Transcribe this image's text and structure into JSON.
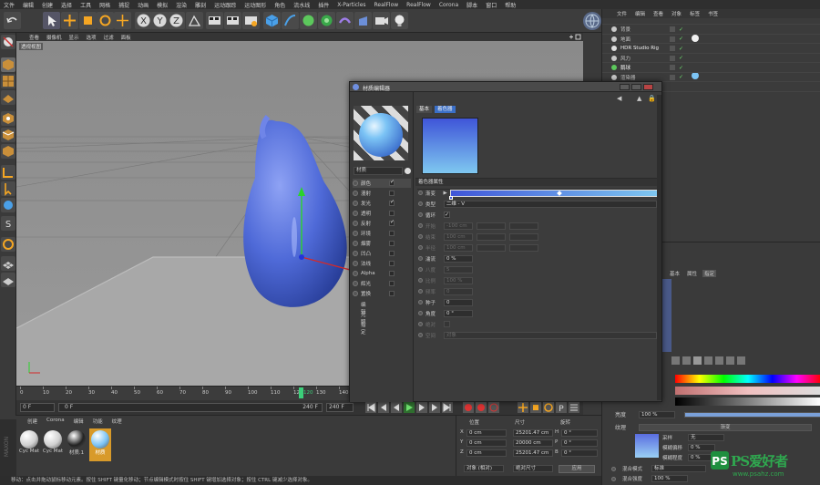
{
  "menubar": [
    "文件",
    "编辑",
    "创建",
    "选择",
    "工具",
    "网格",
    "捕捉",
    "动画",
    "模拟",
    "渲染",
    "雕刻",
    "运动跟踪",
    "运动图形",
    "角色",
    "流水线",
    "插件",
    "X-Particles",
    "RealFlow",
    "RealFlow",
    "Corona",
    "脚本",
    "窗口",
    "帮助"
  ],
  "viewport": {
    "menu": [
      "查看",
      "摄像机",
      "显示",
      "选项",
      "过滤",
      "面板"
    ],
    "label": "透视视图"
  },
  "timeline": {
    "ticks": [
      "0",
      "10",
      "20",
      "30",
      "40",
      "50",
      "60",
      "70",
      "80",
      "90",
      "100",
      "110",
      "120",
      "130",
      "140"
    ],
    "current_frame_label": "120",
    "start_frame": "0 F",
    "range_start": "0 F",
    "range_end": "240 F",
    "end_frame": "240 F"
  },
  "materials": {
    "menu": [
      "创建",
      "Corona",
      "编辑",
      "功能",
      "纹理"
    ],
    "items": [
      "Cyc Mat",
      "Cyc Mat",
      "材质.1",
      "材质"
    ],
    "selected_index": 3
  },
  "coords": {
    "headers": [
      "位置",
      "尺寸",
      "旋转"
    ],
    "rows": [
      {
        "axis": "X",
        "pos": "0 cm",
        "size": "25201.47 cm",
        "rot_axis": "H",
        "rot": "0 °"
      },
      {
        "axis": "Y",
        "pos": "0 cm",
        "size": "20000 cm",
        "rot_axis": "P",
        "rot": "0 °"
      },
      {
        "axis": "Z",
        "pos": "0 cm",
        "size": "25201.47 cm",
        "rot_axis": "B",
        "rot": "0 °"
      }
    ],
    "mode_select": "对象 (相对)",
    "size_select": "绝对尺寸",
    "apply_label": "应用"
  },
  "status_text": "移动：点击并拖动鼠标移动元素。按住 SHIFT 键量化移动；节点编辑模式时按住 SHIFT 键增加选择对象；按住 CTRL 键减少选择对象。",
  "objects": {
    "menu": [
      "文件",
      "编辑",
      "查看",
      "对象",
      "标签",
      "书签"
    ],
    "rows": [
      "背景",
      "地面",
      "HDR Studio Rig",
      "风力",
      "鹅球",
      "渲染器"
    ]
  },
  "attr": {
    "tabs": [
      "基本",
      "属性",
      "指定"
    ],
    "mix_label": "亮度",
    "mix_value": "100 %",
    "texture_label": "纹理",
    "texture_button": "渐变",
    "sampling_label": "采样",
    "sampling_value": "无",
    "blur_offset_label": "模糊偏移",
    "blur_offset_value": "0 %",
    "blur_scale_label": "模糊程度",
    "blur_scale_value": "0 %",
    "blend_mode_label": "混合模式",
    "blend_mode_value": "标准",
    "blend_strength_label": "混合强度",
    "blend_strength_value": "100 %"
  },
  "mat_editor": {
    "title": "材质编辑器",
    "mat_name": "材质",
    "channels": [
      {
        "label": "颜色",
        "on": true
      },
      {
        "label": "漫射",
        "on": false
      },
      {
        "label": "发光",
        "on": true
      },
      {
        "label": "透明",
        "on": false
      },
      {
        "label": "反射",
        "on": true
      },
      {
        "label": "环境",
        "on": false
      },
      {
        "label": "烟雾",
        "on": false
      },
      {
        "label": "凹凸",
        "on": false
      },
      {
        "label": "法线",
        "on": false
      },
      {
        "label": "Alpha",
        "on": false
      },
      {
        "label": "辉光",
        "on": false
      },
      {
        "label": "置换",
        "on": false
      }
    ],
    "extra_items": [
      "编辑",
      "光照",
      "指定"
    ],
    "tabs": [
      "基本",
      "着色器"
    ],
    "section_title": "着色器属性",
    "props": [
      {
        "label": "渐变",
        "value": "",
        "dim": false
      },
      {
        "label": "类型",
        "value": "二维 - V",
        "dim": false
      },
      {
        "label": "循环",
        "value": "✓",
        "dim": false
      },
      {
        "label": "开始",
        "value": "-100 cm",
        "dim": true
      },
      {
        "label": "结束",
        "value": "100 cm",
        "dim": true
      },
      {
        "label": "半径",
        "value": "100 cm",
        "dim": true
      },
      {
        "label": "湍流",
        "value": "0 %",
        "dim": false
      },
      {
        "label": "八度",
        "value": "5",
        "dim": true
      },
      {
        "label": "比例",
        "value": "100 %",
        "dim": true
      },
      {
        "label": "频率",
        "value": "0",
        "dim": true
      },
      {
        "label": "种子",
        "value": "0",
        "dim": false
      },
      {
        "label": "角度",
        "value": "0 °",
        "dim": false
      },
      {
        "label": "绝对",
        "value": "",
        "dim": true
      },
      {
        "label": "空间",
        "value": "对象",
        "dim": true
      }
    ]
  },
  "watermark": {
    "brand": "PS爱好者",
    "url": "www.psahz.com"
  },
  "colors": {
    "gradient_start": "#3f55d8",
    "gradient_end": "#7fc8f0",
    "accent": "#5aa0f0"
  }
}
